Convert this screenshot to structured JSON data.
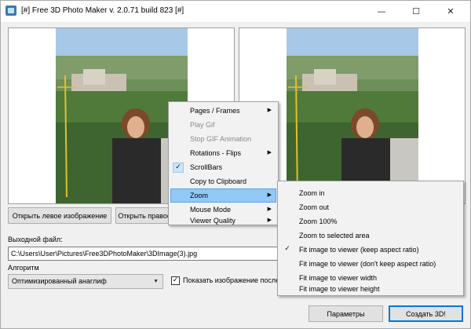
{
  "window": {
    "title": "[#] Free 3D Photo Maker  v. 2.0.71 build 823 [#]",
    "controls": {
      "minimize": "—",
      "maximize": "☐",
      "close": "✕"
    }
  },
  "panels": {
    "open_left_label": "Открыть левое изображение",
    "open_right_label": "Открыть правое изображение"
  },
  "output": {
    "label": "Выходной файл:",
    "path": "C:\\Users\\User\\Pictures\\Free3DPhotoMaker\\3DImage(3).jpg"
  },
  "algorithm": {
    "label": "Алгоритм",
    "selected": "Оптимизированный анаглиф",
    "show_image_label": "Показать изображение после",
    "show_image_checked": true
  },
  "buttons": {
    "params": "Параметры",
    "create": "Создать 3D!"
  },
  "context_menu": {
    "items": [
      {
        "label": "Pages / Frames",
        "enabled": true,
        "submenu": true,
        "checked": false
      },
      {
        "label": "Play Gif",
        "enabled": false,
        "submenu": false,
        "checked": false
      },
      {
        "label": "Stop GIF Animation",
        "enabled": false,
        "submenu": false,
        "checked": false
      },
      {
        "label": "Rotations - Flips",
        "enabled": true,
        "submenu": true,
        "checked": false
      },
      {
        "label": "ScrollBars",
        "enabled": true,
        "submenu": false,
        "checked": true
      },
      {
        "label": "Copy to Clipboard",
        "enabled": true,
        "submenu": false,
        "checked": false
      },
      {
        "label": "Zoom",
        "enabled": true,
        "submenu": true,
        "checked": false,
        "highlighted": true
      },
      {
        "label": "Mouse Mode",
        "enabled": true,
        "submenu": true,
        "checked": false
      },
      {
        "label": "Viewer Quality",
        "enabled": true,
        "submenu": true,
        "checked": false
      }
    ]
  },
  "zoom_menu": {
    "items": [
      {
        "label": "Zoom in",
        "checked": false
      },
      {
        "label": "Zoom out",
        "checked": false
      },
      {
        "label": "Zoom 100%",
        "checked": false
      },
      {
        "label": "Zoom to selected area",
        "checked": false
      },
      {
        "label": "Fit image to viewer (keep aspect ratio)",
        "checked": true
      },
      {
        "label": "Fit image to viewer (don't keep aspect ratio)",
        "checked": false
      },
      {
        "label": "Fit image to viewer width",
        "checked": false
      },
      {
        "label": "Fit image to viewer height",
        "checked": false
      }
    ]
  },
  "icons": {
    "app": "app-icon",
    "check": "check-icon",
    "submenu": "chevron-right-icon",
    "dropdown": "chevron-down-icon"
  },
  "colors": {
    "menu_highlight": "#91c9f7",
    "primary_border": "#0078d7"
  }
}
